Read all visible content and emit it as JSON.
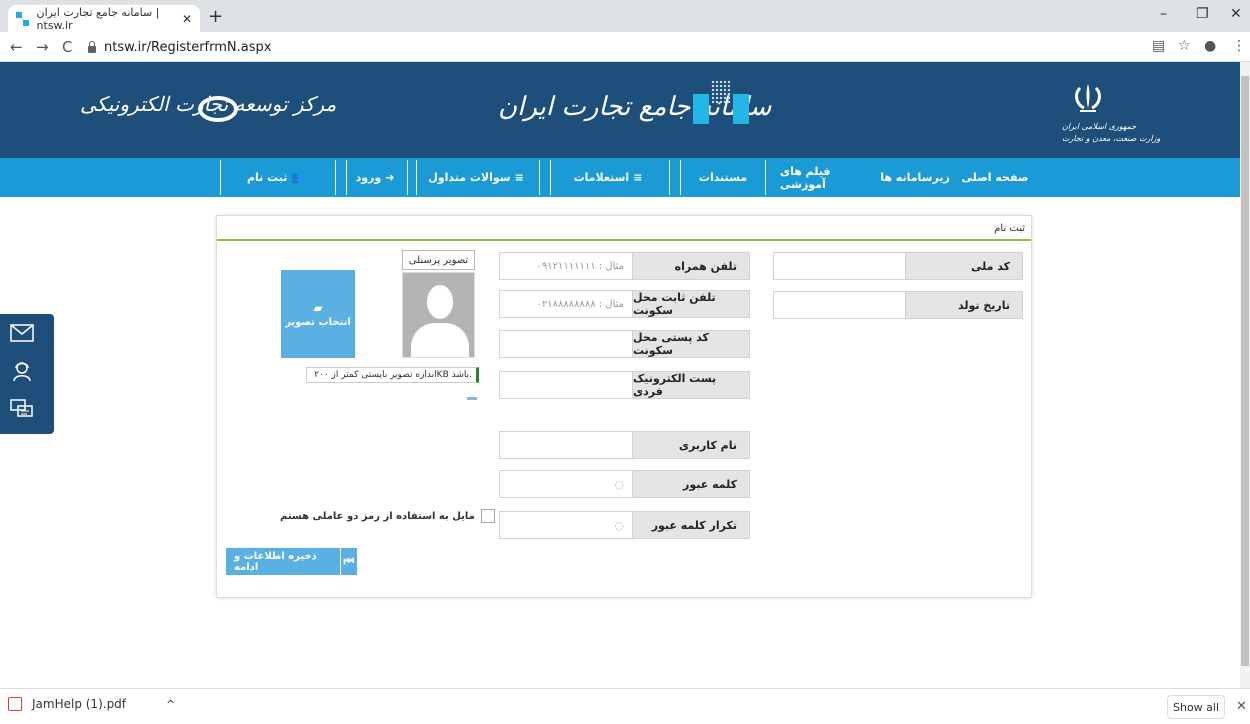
{
  "browser": {
    "tab_title": "سامانه جامع تجارت ایران | ntsw.ir",
    "tab_close": "✕",
    "new_tab": "+",
    "url": "ntsw.ir/RegisterfrmN.aspx",
    "back": "←",
    "forward": "→",
    "reload": "C",
    "minimize": "–",
    "restore": "❐",
    "close": "✕"
  },
  "header": {
    "center_logo_text": "سامانه جامع تجارت ایران",
    "left_logo_text": "مرکز توسعه تجارت الکترونیکی",
    "emblem_line1": "جمهوری اسلامی ایران",
    "emblem_line2": "وزارت صنعت، معدن و تجارت"
  },
  "nav": {
    "home": "صفحه اصلی",
    "subsystems": "زیرسامانه ها",
    "training_films": "فیلم های آموزشی",
    "documents": "مستندات",
    "inquiries": "استعلامات",
    "faq": "سوالات متداول",
    "login": "ورود",
    "register": "ثبت نام"
  },
  "form": {
    "title": "ثبت نام",
    "national_code": {
      "label": "کد ملی",
      "value": ""
    },
    "birth_date": {
      "label": "تاریخ تولد",
      "value": ""
    },
    "mobile": {
      "label": "تلفن همراه",
      "placeholder": "مثال : ۰۹۱۲۱۱۱۱۱۱۱"
    },
    "landline": {
      "label": "تلفن ثابت محل سکونت",
      "placeholder": "مثال : ۰۲۱۸۸۸۸۸۸۸۸"
    },
    "postal_code": {
      "label": "کد پستی محل سکونت",
      "value": ""
    },
    "email": {
      "label": "پست الکترونیک فردی",
      "value": ""
    },
    "username": {
      "label": "نام کاربری",
      "value": ""
    },
    "password": {
      "label": "کلمه عبور",
      "value": ""
    },
    "password_repeat": {
      "label": "تکرار کلمه عبور",
      "value": ""
    },
    "photo_label": "تصویر پرسنلی",
    "choose_photo": "انتخاب تصویر",
    "photo_note": "اندازه تصویر بایستی کمتر از ۲۰۰KB باشد.",
    "two_factor": "مایل به استفاده از رمز دو عاملی هستم",
    "save_button": "ذخیره اطلاعات و ادامه"
  },
  "downloads": {
    "file": "JamHelp (1).pdf",
    "chevron": "^",
    "show_all": "Show all",
    "close": "✕"
  }
}
